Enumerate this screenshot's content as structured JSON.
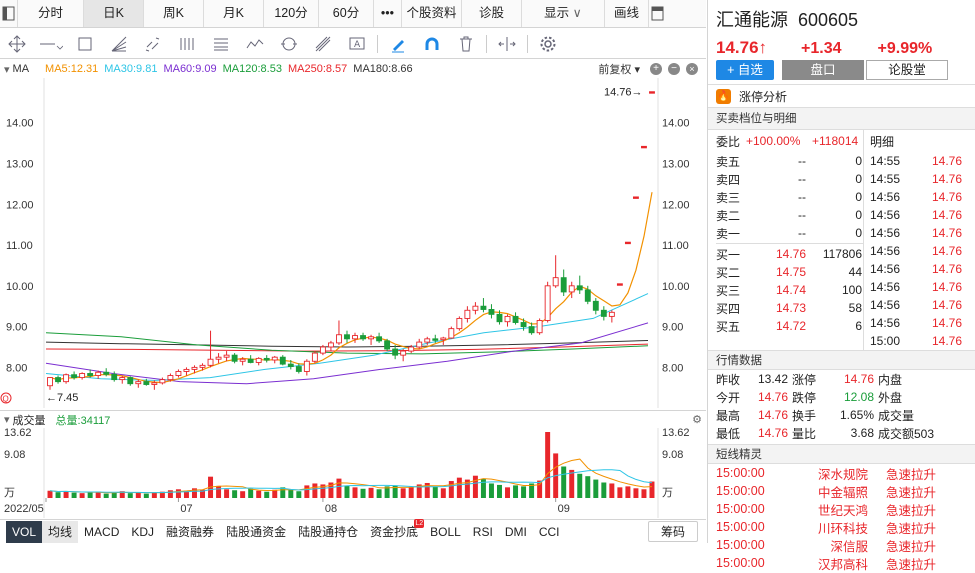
{
  "tabs": {
    "items": [
      "分时",
      "日K",
      "周K",
      "月K",
      "120分",
      "60分"
    ],
    "more": "•••",
    "f10": "个股资料",
    "diagnose": "诊股",
    "display": "显示",
    "draw": "画线"
  },
  "legend": {
    "ma": "MA",
    "ma5": "MA5:12.31",
    "ma30": "MA30:9.81",
    "ma60": "MA60:9.09",
    "ma120": "MA120:8.53",
    "ma250": "MA250:8.57",
    "ma180": "MA180:8.66",
    "adjust": "前复权"
  },
  "price_axis": {
    "labels": [
      "14.00",
      "13.00",
      "12.00",
      "11.00",
      "10.00",
      "9.00",
      "8.00"
    ],
    "high_marker": "14.76→",
    "low_marker": "←7.45",
    "q_marker": "Q"
  },
  "volume": {
    "title": "成交量",
    "total": "总量:34117",
    "axis": [
      "13.62",
      "9.08",
      "万"
    ]
  },
  "dates": [
    "2022/05",
    "07",
    "08",
    "09"
  ],
  "bottom_tabs": [
    "VOL",
    "均线",
    "MACD",
    "KDJ",
    "融资融券",
    "陆股通资金",
    "陆股通持仓",
    "资金抄底",
    "BOLL",
    "RSI",
    "DMI",
    "CCI"
  ],
  "bottom_badge": "L2",
  "bottom_right": "筹码",
  "stock": {
    "name": "汇通能源",
    "code": "600605",
    "price": "14.76",
    "arrow": "↑",
    "change": "+1.34",
    "pct": "+9.99%"
  },
  "buttons": {
    "add": "+ 自选",
    "pankou": "盘口",
    "lungutang": "论股堂"
  },
  "limit_analysis": "涨停分析",
  "order_section": "买卖档位与明细",
  "weibi": {
    "label": "委比",
    "pct": "+100.00%",
    "diff": "+118014",
    "detail": "明细"
  },
  "asks": [
    {
      "n": "卖五",
      "p": "--",
      "v": "0"
    },
    {
      "n": "卖四",
      "p": "--",
      "v": "0"
    },
    {
      "n": "卖三",
      "p": "--",
      "v": "0"
    },
    {
      "n": "卖二",
      "p": "--",
      "v": "0"
    },
    {
      "n": "卖一",
      "p": "--",
      "v": "0"
    }
  ],
  "bids": [
    {
      "n": "买一",
      "p": "14.76",
      "v": "117806"
    },
    {
      "n": "买二",
      "p": "14.75",
      "v": "44"
    },
    {
      "n": "买三",
      "p": "14.74",
      "v": "100"
    },
    {
      "n": "买四",
      "p": "14.73",
      "v": "58"
    },
    {
      "n": "买五",
      "p": "14.72",
      "v": "6"
    }
  ],
  "ticks": [
    {
      "t": "14:55",
      "p": "14.76"
    },
    {
      "t": "14:55",
      "p": "14.76"
    },
    {
      "t": "14:56",
      "p": "14.76"
    },
    {
      "t": "14:56",
      "p": "14.76"
    },
    {
      "t": "14:56",
      "p": "14.76"
    },
    {
      "t": "14:56",
      "p": "14.76"
    },
    {
      "t": "14:56",
      "p": "14.76"
    },
    {
      "t": "14:56",
      "p": "14.76"
    },
    {
      "t": "14:56",
      "p": "14.76"
    },
    {
      "t": "14:56",
      "p": "14.76"
    },
    {
      "t": "15:00",
      "p": "14.76"
    }
  ],
  "quote_section": "行情数据",
  "quote": [
    {
      "l1": "昨收",
      "v1": "13.42",
      "c1": "n",
      "l2": "涨停",
      "v2": "14.76",
      "c2": "r",
      "l3": "内盘"
    },
    {
      "l1": "今开",
      "v1": "14.76",
      "c1": "r",
      "l2": "跌停",
      "v2": "12.08",
      "c2": "g",
      "l3": "外盘"
    },
    {
      "l1": "最高",
      "v1": "14.76",
      "c1": "r",
      "l2": "换手",
      "v2": "1.65%",
      "c2": "n",
      "l3": "成交量"
    },
    {
      "l1": "最低",
      "v1": "14.76",
      "c1": "r",
      "l2": "量比",
      "v2": "3.68",
      "c2": "n",
      "l3": "成交额503"
    }
  ],
  "short_section": "短线精灵",
  "short": [
    {
      "t": "15:00:00",
      "s": "深水规院",
      "e": "急速拉升"
    },
    {
      "t": "15:00:00",
      "s": "中金辐照",
      "e": "急速拉升"
    },
    {
      "t": "15:00:00",
      "s": "世纪天鸿",
      "e": "急速拉升"
    },
    {
      "t": "15:00:00",
      "s": "川环科技",
      "e": "急速拉升"
    },
    {
      "t": "15:00:00",
      "s": "深信服",
      "e": "急速拉升"
    },
    {
      "t": "15:00:00",
      "s": "汉邦高科",
      "e": "急速拉升"
    }
  ],
  "colors": {
    "up": "#e8262b",
    "down": "#1a9d3a",
    "ma5": "#f29100",
    "ma30": "#2ec5e6",
    "ma60": "#7b2fd1",
    "ma120": "#1a9d3a",
    "ma250": "#e8262b",
    "ma180": "#333333",
    "accent": "#1e88e5"
  },
  "chart_data": {
    "type": "candlestick",
    "y_range": [
      7.2,
      14.9
    ],
    "volume_range": [
      0,
      13.62
    ],
    "volume_unit": "万",
    "candles": [
      [
        7.55,
        7.75,
        7.45,
        7.75
      ],
      [
        7.75,
        7.8,
        7.6,
        7.65
      ],
      [
        7.65,
        7.85,
        7.6,
        7.82
      ],
      [
        7.82,
        7.9,
        7.7,
        7.75
      ],
      [
        7.75,
        7.88,
        7.7,
        7.85
      ],
      [
        7.85,
        7.95,
        7.75,
        7.8
      ],
      [
        7.8,
        7.92,
        7.72,
        7.88
      ],
      [
        7.88,
        7.98,
        7.78,
        7.83
      ],
      [
        7.83,
        7.9,
        7.65,
        7.7
      ],
      [
        7.7,
        7.8,
        7.6,
        7.75
      ],
      [
        7.75,
        7.78,
        7.55,
        7.6
      ],
      [
        7.6,
        7.7,
        7.5,
        7.65
      ],
      [
        7.65,
        7.72,
        7.55,
        7.58
      ],
      [
        7.58,
        7.68,
        7.45,
        7.62
      ],
      [
        7.62,
        7.75,
        7.58,
        7.7
      ],
      [
        7.7,
        7.85,
        7.65,
        7.8
      ],
      [
        7.8,
        7.95,
        7.75,
        7.9
      ],
      [
        7.9,
        8.0,
        7.8,
        7.95
      ],
      [
        7.95,
        8.05,
        7.85,
        8.0
      ],
      [
        8.0,
        8.1,
        7.92,
        8.05
      ],
      [
        8.05,
        8.9,
        8.0,
        8.2
      ],
      [
        8.2,
        8.35,
        8.1,
        8.25
      ],
      [
        8.25,
        8.4,
        8.15,
        8.3
      ],
      [
        8.3,
        8.35,
        8.1,
        8.15
      ],
      [
        8.15,
        8.25,
        8.05,
        8.2
      ],
      [
        8.2,
        8.3,
        8.1,
        8.12
      ],
      [
        8.12,
        8.25,
        8.05,
        8.22
      ],
      [
        8.22,
        8.3,
        8.12,
        8.18
      ],
      [
        8.18,
        8.28,
        8.1,
        8.25
      ],
      [
        8.25,
        8.3,
        8.05,
        8.08
      ],
      [
        8.08,
        8.18,
        7.95,
        8.02
      ],
      [
        8.02,
        8.1,
        7.85,
        7.9
      ],
      [
        7.9,
        8.2,
        7.8,
        8.15
      ],
      [
        8.15,
        8.4,
        8.1,
        8.35
      ],
      [
        8.35,
        8.55,
        8.3,
        8.5
      ],
      [
        8.5,
        8.65,
        8.4,
        8.6
      ],
      [
        8.6,
        9.15,
        8.55,
        8.8
      ],
      [
        8.8,
        8.9,
        8.6,
        8.7
      ],
      [
        8.7,
        8.85,
        8.6,
        8.78
      ],
      [
        8.78,
        8.85,
        8.65,
        8.7
      ],
      [
        8.7,
        8.8,
        8.55,
        8.75
      ],
      [
        8.75,
        8.85,
        8.6,
        8.65
      ],
      [
        8.65,
        8.7,
        8.4,
        8.45
      ],
      [
        8.45,
        8.55,
        8.2,
        8.3
      ],
      [
        8.3,
        8.45,
        8.15,
        8.4
      ],
      [
        8.4,
        8.55,
        8.35,
        8.5
      ],
      [
        8.5,
        8.7,
        8.45,
        8.62
      ],
      [
        8.62,
        8.75,
        8.55,
        8.7
      ],
      [
        8.7,
        8.8,
        8.6,
        8.68
      ],
      [
        8.68,
        8.75,
        8.55,
        8.72
      ],
      [
        8.72,
        9.0,
        8.7,
        8.95
      ],
      [
        8.95,
        9.25,
        8.9,
        9.2
      ],
      [
        9.2,
        9.5,
        9.1,
        9.4
      ],
      [
        9.4,
        9.6,
        9.3,
        9.5
      ],
      [
        9.5,
        9.7,
        9.35,
        9.42
      ],
      [
        9.42,
        9.55,
        9.2,
        9.3
      ],
      [
        9.3,
        9.4,
        9.05,
        9.12
      ],
      [
        9.12,
        9.3,
        9.0,
        9.25
      ],
      [
        9.25,
        9.35,
        9.05,
        9.1
      ],
      [
        9.1,
        9.2,
        8.9,
        9.0
      ],
      [
        9.0,
        9.1,
        8.8,
        8.85
      ],
      [
        8.85,
        9.2,
        8.8,
        9.15
      ],
      [
        9.15,
        10.1,
        9.1,
        10.0
      ],
      [
        10.0,
        10.75,
        9.95,
        10.2
      ],
      [
        10.2,
        10.4,
        9.75,
        9.85
      ],
      [
        9.85,
        10.1,
        9.7,
        10.0
      ],
      [
        10.0,
        10.25,
        9.8,
        9.9
      ],
      [
        9.9,
        10.0,
        9.55,
        9.62
      ],
      [
        9.62,
        9.7,
        9.3,
        9.4
      ],
      [
        9.4,
        9.5,
        9.15,
        9.25
      ],
      [
        9.25,
        9.4,
        9.1,
        9.35
      ],
      [
        10.05,
        10.05,
        10.05,
        10.05
      ],
      [
        11.07,
        11.07,
        11.07,
        11.07
      ],
      [
        12.18,
        12.18,
        12.18,
        12.18
      ],
      [
        13.42,
        13.42,
        13.42,
        13.42
      ],
      [
        14.76,
        14.76,
        14.76,
        14.76
      ]
    ],
    "volumes": [
      1.5,
      1.2,
      1.4,
      1.1,
      1.0,
      1.2,
      1.3,
      0.9,
      1.1,
      1.4,
      1.0,
      1.2,
      0.9,
      1.1,
      1.3,
      1.6,
      1.8,
      1.5,
      2.0,
      1.7,
      4.4,
      2.5,
      1.8,
      1.6,
      1.4,
      1.9,
      1.5,
      1.3,
      1.7,
      2.2,
      1.8,
      1.4,
      2.6,
      3.0,
      2.8,
      3.2,
      4.0,
      2.5,
      2.2,
      1.9,
      2.1,
      1.8,
      2.4,
      2.6,
      2.0,
      2.3,
      2.8,
      3.1,
      2.4,
      2.0,
      3.5,
      4.2,
      3.8,
      4.6,
      3.9,
      3.0,
      2.7,
      2.2,
      2.6,
      2.4,
      3.0,
      3.6,
      13.62,
      9.2,
      6.5,
      5.8,
      5.0,
      4.5,
      3.8,
      3.2,
      3.0,
      2.2,
      2.4,
      2.0,
      1.8,
      3.4
    ]
  }
}
